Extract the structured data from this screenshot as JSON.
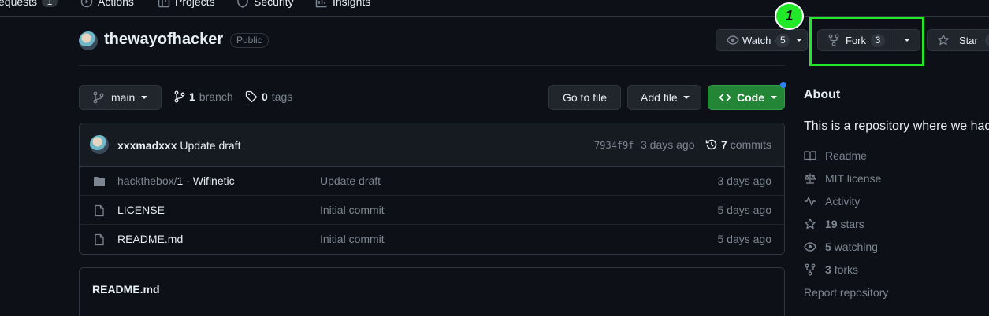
{
  "topnav": {
    "pull_requests_label": "equests",
    "pull_requests_count": "1",
    "actions_label": "Actions",
    "projects_label": "Projects",
    "security_label": "Security",
    "insights_label": "Insights"
  },
  "repo": {
    "name": "thewayofhacker",
    "visibility": "Public"
  },
  "actions": {
    "watch_label": "Watch",
    "watch_count": "5",
    "fork_label": "Fork",
    "fork_count": "3",
    "star_label": "Star"
  },
  "annotation": {
    "step": "1",
    "color": "#22e82a"
  },
  "toolbar": {
    "branch": "main",
    "branch_count": "1",
    "branch_word": "branch",
    "tag_count": "0",
    "tag_word": "tags",
    "go_to_file": "Go to file",
    "add_file": "Add file",
    "code": "Code"
  },
  "latest_commit": {
    "author": "xxxmadxxx",
    "message": "Update draft",
    "hash": "7934f9f",
    "age": "3 days ago",
    "commit_count": "7",
    "commit_word": "commits"
  },
  "files": [
    {
      "type": "folder",
      "name_prefix": "hackthebox/",
      "name": "1 - Wifinetic",
      "message": "Update draft",
      "age": "3 days ago"
    },
    {
      "type": "file",
      "name": "LICENSE",
      "message": "Initial commit",
      "age": "5 days ago"
    },
    {
      "type": "file",
      "name": "README.md",
      "message": "Initial commit",
      "age": "5 days ago"
    }
  ],
  "readme": {
    "title": "README.md"
  },
  "about": {
    "title": "About",
    "description": "This is a repository where we hac",
    "readme": "Readme",
    "license": "MIT license",
    "activity": "Activity",
    "stars_count": "19",
    "stars_word": "stars",
    "watching_count": "5",
    "watching_word": "watching",
    "forks_count": "3",
    "forks_word": "forks",
    "report": "Report repository"
  },
  "colors": {
    "background": "#0d1117",
    "code_button": "#238636",
    "highlight": "#22e82a",
    "notification_dot": "#2f81f7"
  }
}
